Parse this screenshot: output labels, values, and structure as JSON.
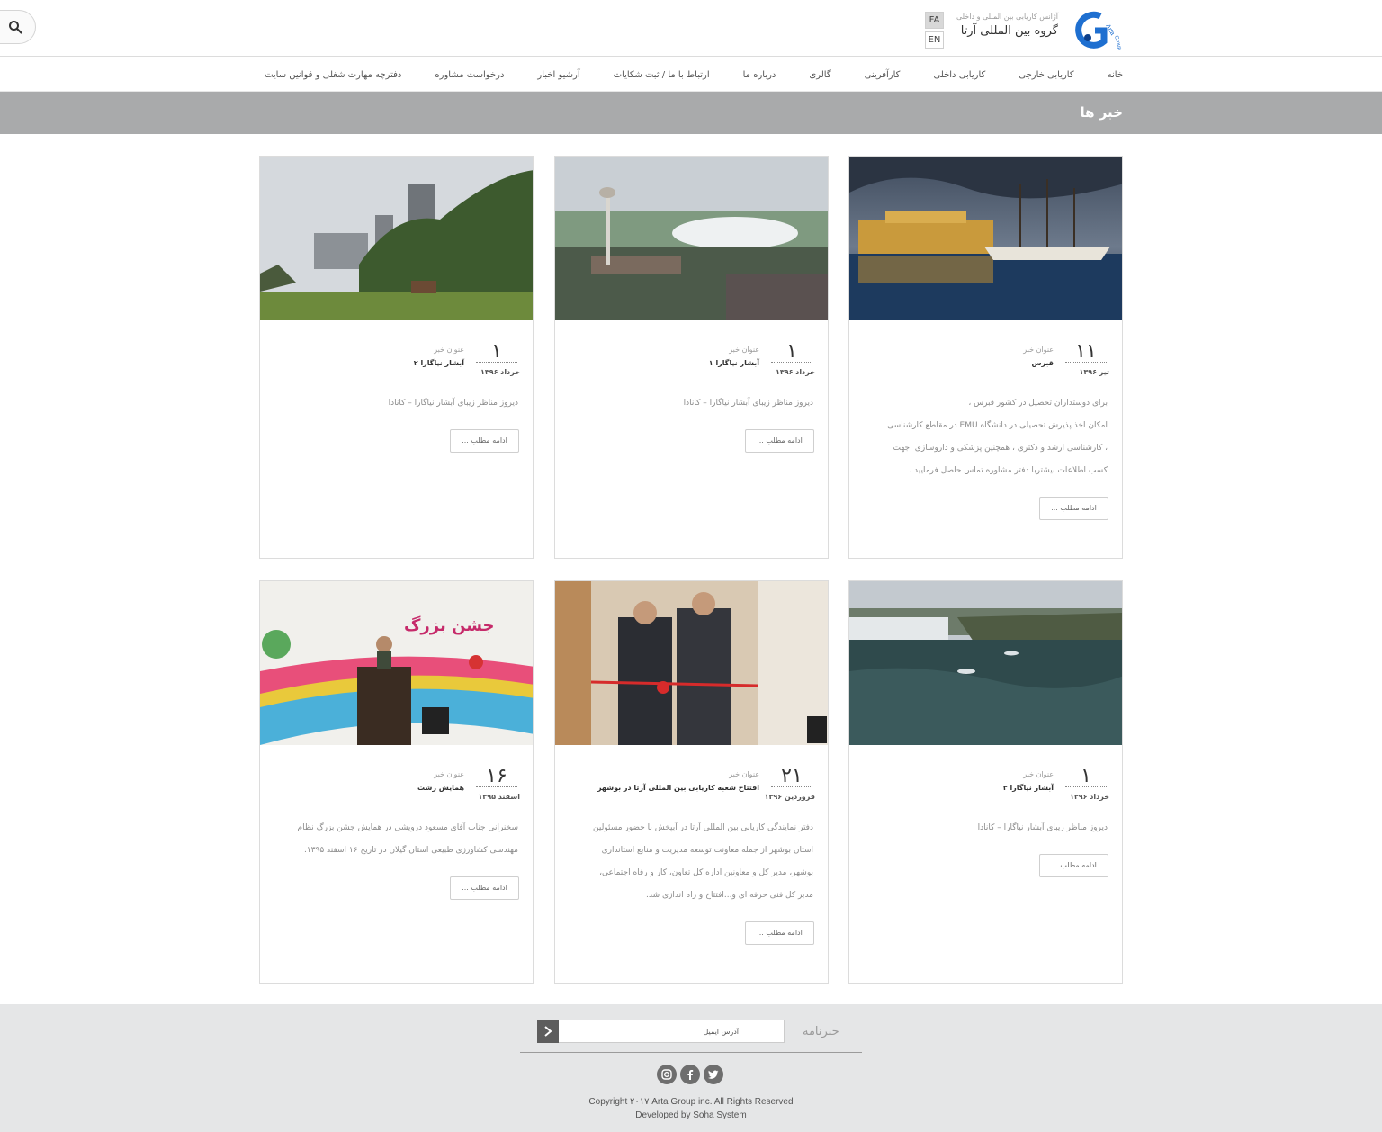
{
  "header": {
    "search_icon": "search-icon",
    "brand_subtitle": "آژانس کاریابی بین المللی و داخلی",
    "brand_title": "گروه بین المللی آرتا",
    "logo_text": "Arta Group",
    "languages": [
      "FA",
      "EN"
    ],
    "active_language": "FA"
  },
  "nav": {
    "items": [
      "خانه",
      "کاریابی خارجی",
      "کاریابی داخلی",
      "کارآفرینی",
      "گالری",
      "درباره ما",
      "ارتباط با ما / ثبت شکایات",
      "آرشیو اخبار",
      "درخواست مشاوره",
      "دفترچه مهارت شغلی و قوانین سایت"
    ]
  },
  "page": {
    "title": "خبر ها"
  },
  "cards": [
    {
      "image": "harbor-castle-photo",
      "day": "۱۱",
      "month": "تیر ۱۳۹۶",
      "label": "عنوان خبر",
      "title": "قبرس",
      "lines": [
        "برای دوستداران تحصیل در کشور قبرس ،",
        "امکان اخذ پذیرش تحصیلی در دانشگاه EMU در مقاطع کارشناسی",
        "، کارشناسی ارشد و دکتری ، همچنین پزشکی و داروسازی .جهت",
        "کسب اطلاعات بیشتربا دفتر مشاوره تماس حاصل فرمایید ."
      ],
      "more": "ادامه مطلب ..."
    },
    {
      "image": "niagara-tower-photo",
      "day": "۱",
      "month": "خرداد ۱۳۹۶",
      "label": "عنوان خبر",
      "title": "آبشار نیاگارا ۱",
      "lines": [
        "دیروز مناظر زیبای آبشار نیاگارا – کانادا"
      ],
      "more": "ادامه مطلب ..."
    },
    {
      "image": "niagara-city-photo",
      "day": "۱",
      "month": "خرداد ۱۳۹۶",
      "label": "عنوان خبر",
      "title": "آبشار نیاگارا ۲",
      "lines": [
        "دیروز مناظر زیبای آبشار نیاگارا – کانادا"
      ],
      "more": "ادامه مطلب ..."
    },
    {
      "image": "niagara-river-photo",
      "day": "۱",
      "month": "خرداد ۱۳۹۶",
      "label": "عنوان خبر",
      "title": "آبشار نیاگارا ۳",
      "lines": [
        "دیروز مناظر زیبای آبشار نیاگارا – کانادا"
      ],
      "more": "ادامه مطلب ..."
    },
    {
      "image": "ribbon-cutting-photo",
      "day": "۲۱",
      "month": "فروردین ۱۳۹۶",
      "label": "عنوان خبر",
      "title": "افتتاح شعبه کاریابی بین المللی آرتا در بوشهر",
      "lines": [
        "دفتر نمایندگی کاریابی بین المللی آرتا در آبپخش با حضور مسئولین",
        "استان بوشهر از جمله معاونت توسعه مدیریت و منابع استانداری",
        "بوشهر، مدیر کل و معاونین اداره کل تعاون، کار و رفاه اجتماعی،",
        "مدیر کل فنی حرفه ای و...افتتاح و راه اندازی شد."
      ],
      "more": "ادامه مطلب ..."
    },
    {
      "image": "conference-speech-photo",
      "day": "۱۶",
      "month": "اسفند ۱۳۹۵",
      "label": "عنوان خبر",
      "title": "همایش رشت",
      "lines": [
        "سخنرانی جناب آقای مسعود درویشی در همایش جشن بزرگ نظام",
        "مهندسی کشاورزی طبیعی استان گیلان در تاریخ ۱۶ اسفند ۱۳۹۵."
      ],
      "more": "ادامه مطلب ..."
    }
  ],
  "footer": {
    "newsletter_label": "خبرنامه",
    "email_placeholder": "آدرس ایمیل",
    "social_icons": [
      "instagram-icon",
      "facebook-icon",
      "twitter-icon"
    ],
    "copyright": "Copyright ۲۰۱۷ Arta Group inc. All Rights Reserved",
    "developed_by": "Developed by Soha System"
  },
  "colors": {
    "banner": "#a9aaab",
    "footer": "#e5e6e7",
    "accent_blue": "#1e6fd0"
  }
}
